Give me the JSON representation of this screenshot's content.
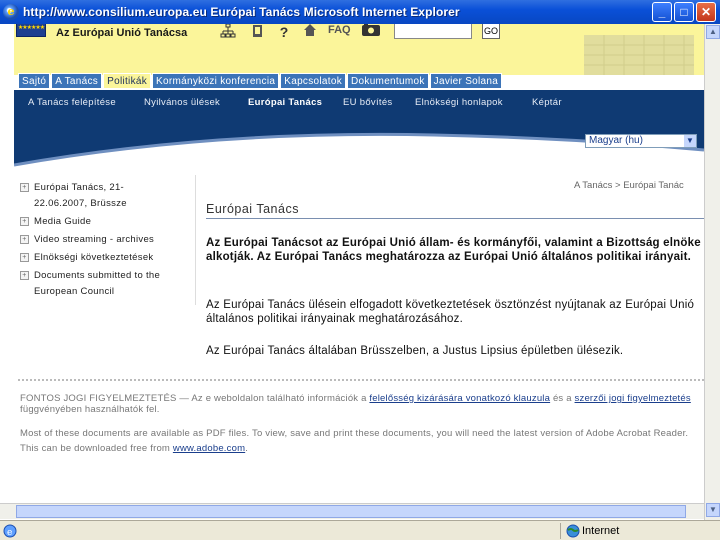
{
  "window": {
    "title": "http://www.consilium.europa.eu   Európai Tanács   Microsoft Internet Explorer",
    "minimize": "_",
    "maximize": "□",
    "close": "✕"
  },
  "header": {
    "site_name": "Az Európai Unió Tanácsa",
    "faq_label": "FAQ",
    "search_placeholder": "",
    "go_label": "GO",
    "icons": [
      "sitemap-icon",
      "print-icon",
      "help-icon",
      "home-icon",
      "rss-icon"
    ]
  },
  "tabs": [
    {
      "label": "Sajtó",
      "active": false
    },
    {
      "label": "A Tanács",
      "active": false
    },
    {
      "label": "Politikák",
      "active": true
    },
    {
      "label": "Kormányközi konferencia",
      "active": false
    },
    {
      "label": "Kapcsolatok",
      "active": false
    },
    {
      "label": "Dokumentumok",
      "active": false
    },
    {
      "label": "Javier Solana",
      "active": false
    }
  ],
  "subnav": [
    {
      "label": "A Tanács felépítése",
      "active": false
    },
    {
      "label": "Nyilvános ülések",
      "active": false
    },
    {
      "label": "Európai Tanács",
      "active": true
    },
    {
      "label": "EU bővítés",
      "active": false
    },
    {
      "label": "Elnökségi honlapok",
      "active": false
    },
    {
      "label": "Képtár",
      "active": false
    }
  ],
  "language": {
    "selected": "Magyar (hu)"
  },
  "sidebar": {
    "items": [
      {
        "lines": [
          "Európai Tanács, 21-",
          "22.06.2007, Brüssze"
        ]
      },
      {
        "lines": [
          "Media Guide"
        ]
      },
      {
        "lines": [
          "Video streaming - archives"
        ]
      },
      {
        "lines": [
          "Elnökségi következtetések"
        ]
      },
      {
        "lines": [
          "Documents submitted to the",
          "European Council"
        ]
      }
    ]
  },
  "breadcrumb": "A Tanács > Európai Tanác",
  "main": {
    "title": "Európai Tanács",
    "lead": "Az Európai Tanácsot az Európai Unió állam- és kormányfői, valamint a Bizottság elnöke alkotják. Az Európai Tanács meghatározza az Európai Unió általános politikai irányait.",
    "para1": "Az Európai Tanács ülésein elfogadott következtetések ösztönzést nyújtanak az Európai Unió általános politikai irányainak meghatározásához.",
    "para2": "Az Európai Tanács általában Brüsszelben, a Justus Lipsius épületben ülésezik."
  },
  "footer": {
    "disclaimer_prefix": "FONTOS JOGI FIGYELMEZTETÉS — Az e weboldalon található információk a ",
    "disclaimer_link1": "felelősség kizárására vonatkozó klauzula",
    "disclaimer_mid": " és a ",
    "disclaimer_link2": "szerzői jogi figyelmeztetés",
    "disclaimer_suffix": " függvényében használhatók fel.",
    "pdf_text": "Most of these documents are available as PDF files. To view, save and print these documents, you will need the latest version of Adobe Acrobat Reader. This can be downloaded free from ",
    "pdf_link": "www.adobe.com",
    "pdf_end": "."
  },
  "status": {
    "zone": "Internet"
  }
}
